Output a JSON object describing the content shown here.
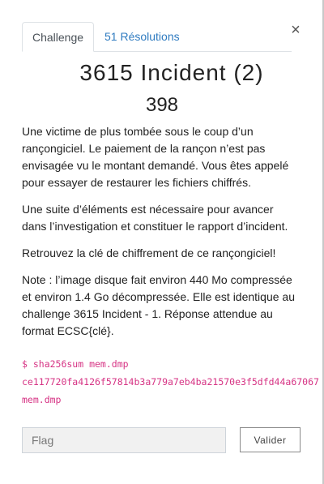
{
  "tabs": {
    "challenge": "Challenge",
    "solves": "51 Résolutions"
  },
  "close_symbol": "×",
  "challenge": {
    "name": "3615 Incident (2)",
    "value": "398",
    "description": [
      "Une victime de plus tombée sous le coup d’un rançongiciel. Le paiement de la rançon n’est pas envisagée vu le montant demandé. Vous êtes appelé pour essayer de restaurer les fichiers chiffrés.",
      "Une suite d’éléments est nécessaire pour avancer dans l’investigation et constituer le rapport d’incident.",
      "Retrouvez la clé de chiffrement de ce rançongiciel!",
      "Note : l’image disque fait environ 440 Mo compressée et environ 1.4 Go décompressée. Elle est identique au challenge 3615 Incident - 1. Réponse attendue au format ECSC{clé}."
    ],
    "code_lines": [
      "$ sha256sum mem.dmp",
      "ce117720fa4126f57814b3a779a7eb4ba21570e3f5dfd44a67067",
      "mem.dmp"
    ]
  },
  "form": {
    "flag_placeholder": "Flag",
    "flag_value": "",
    "submit_label": "Valider"
  }
}
